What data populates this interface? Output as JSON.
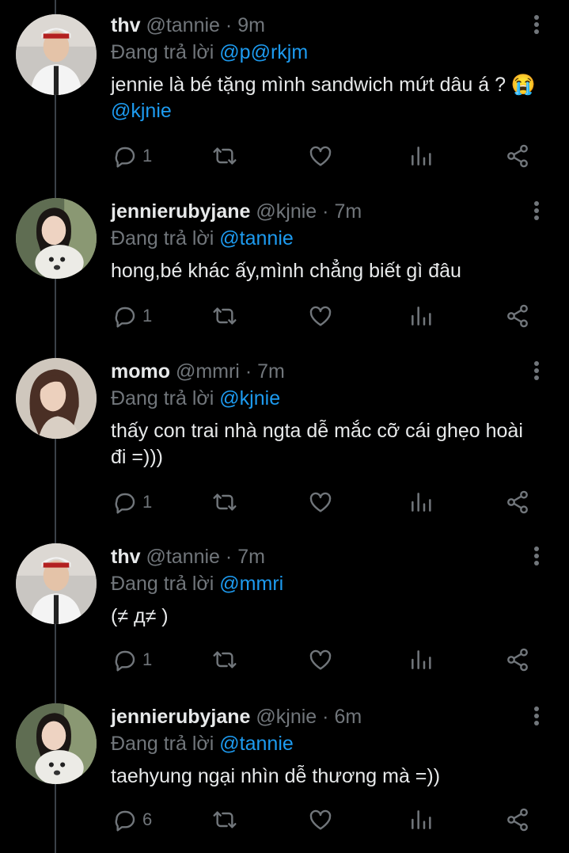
{
  "tweets": [
    {
      "name": "thv",
      "handle": "@tannie",
      "time": "9m",
      "reply_prefix": "Đang trả lời",
      "reply_to": "@p@rkjm",
      "text": "jennie là bé tặng mình sandwich mứt dâu á ? 😭",
      "text_mention": "@kjnie",
      "replies": "1",
      "avatar": "boy"
    },
    {
      "name": "jennierubyjane",
      "handle": "@kjnie",
      "time": "7m",
      "reply_prefix": "Đang trả lời",
      "reply_to": "@tannie",
      "text": "hong,bé khác ấy,mình chẳng biết gì đâu",
      "text_mention": "",
      "replies": "1",
      "avatar": "girl-dog"
    },
    {
      "name": "momo",
      "handle": "@mmri",
      "time": "7m",
      "reply_prefix": "Đang trả lời",
      "reply_to": "@kjnie",
      "text": "thấy con trai nhà ngta dễ mắc cỡ cái ghẹo hoài đi =)))",
      "text_mention": "",
      "replies": "1",
      "avatar": "girl"
    },
    {
      "name": "thv",
      "handle": "@tannie",
      "time": "7m",
      "reply_prefix": "Đang trả lời",
      "reply_to": "@mmri",
      "text": "(≠ д≠ )",
      "text_mention": "",
      "replies": "1",
      "avatar": "boy"
    },
    {
      "name": "jennierubyjane",
      "handle": "@kjnie",
      "time": "6m",
      "reply_prefix": "Đang trả lời",
      "reply_to": "@tannie",
      "text": "taehyung ngại nhìn dễ thương mà =))",
      "text_mention": "",
      "replies": "6",
      "avatar": "girl-dog"
    }
  ],
  "separator": "·",
  "colors": {
    "background": "#000000",
    "text": "#e7e9ea",
    "muted": "#71767b",
    "link": "#1d9bf0",
    "thread_line": "#3b4148"
  },
  "icons": [
    "reply-icon",
    "retweet-icon",
    "like-icon",
    "analytics-icon",
    "share-icon",
    "more-icon"
  ]
}
